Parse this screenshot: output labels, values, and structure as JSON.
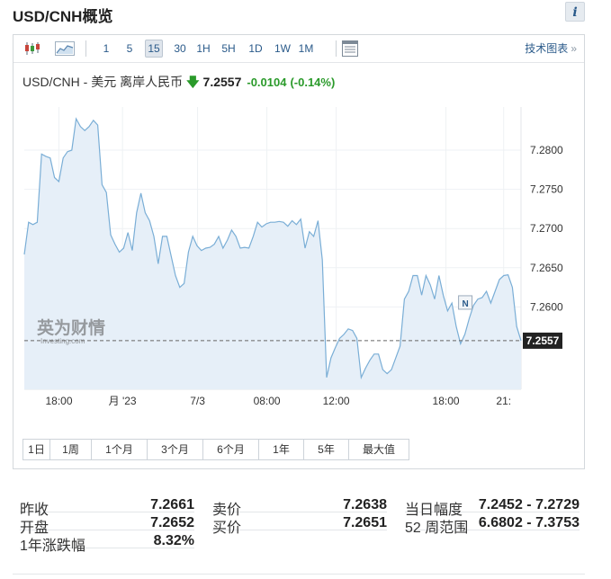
{
  "page": {
    "title": "USD/CNH概览",
    "info_icon": "i"
  },
  "toolbar": {
    "icons": [
      "candlestick-icon",
      "area-chart-icon",
      "settings-panel-icon"
    ],
    "timeframes": [
      "1",
      "5",
      "15",
      "30",
      "1H",
      "5H",
      "1D",
      "1W",
      "1M"
    ],
    "active_timeframe": "15",
    "tech_link": "技术图表",
    "tech_arrow": "»"
  },
  "quote": {
    "name": "USD/CNH - 美元 离岸人民币",
    "direction": "down",
    "arrow": "🡇",
    "price": "7.2557",
    "change": "-0.0104",
    "change_pct": "(-0.14%)"
  },
  "watermark": {
    "cn": "英为财情",
    "en": "Investing.com"
  },
  "news_marker": "N",
  "colors": {
    "line": "#7aaed6",
    "fill": "#e6eff8",
    "up": "#2a9a2a",
    "link": "#2a5a8a"
  },
  "chart_data": {
    "type": "area",
    "series": [
      {
        "values": [
          7.2667,
          7.2708,
          7.2705,
          7.2708,
          7.2795,
          7.2792,
          7.279,
          7.2765,
          7.276,
          7.279,
          7.2798,
          7.28,
          7.284,
          7.283,
          7.2825,
          7.283,
          7.2838,
          7.2832,
          7.2756,
          7.2746,
          7.2692,
          7.268,
          7.267,
          7.2675,
          7.2695,
          7.2672,
          7.272,
          7.2745,
          7.272,
          7.271,
          7.269,
          7.2655,
          7.269,
          7.269,
          7.2665,
          7.264,
          7.2625,
          7.263,
          7.267,
          7.269,
          7.2678,
          7.2672,
          7.2675,
          7.2676,
          7.268,
          7.269,
          7.2675,
          7.2685,
          7.2698,
          7.269,
          7.2675,
          7.2676,
          7.2675,
          7.269,
          7.2708,
          7.2702,
          7.2706,
          7.2708,
          7.2708,
          7.2709,
          7.2708,
          7.2703,
          7.271,
          7.2705,
          7.2712,
          7.2675,
          7.2696,
          7.269,
          7.271,
          7.266,
          7.251,
          7.2535,
          7.2548,
          7.256,
          7.2565,
          7.2572,
          7.257,
          7.256,
          7.251,
          7.2522,
          7.2532,
          7.254,
          7.254,
          7.252,
          7.2515,
          7.252,
          7.2535,
          7.255,
          7.261,
          7.262,
          7.264,
          7.264,
          7.2615,
          7.264,
          7.2628,
          7.261,
          7.264,
          7.2615,
          7.2595,
          7.2605,
          7.2575,
          7.2553,
          7.2565,
          7.2585,
          7.2602,
          7.261,
          7.2612,
          7.262,
          7.2605,
          7.262,
          7.2635,
          7.264,
          7.2641,
          7.2625,
          7.2575,
          7.2557
        ]
      }
    ],
    "x_ticks": [
      "18:00",
      "月 '23",
      "7/3",
      "08:00",
      "12:00",
      "18:00",
      "21:"
    ],
    "y_ticks": [
      7.28,
      7.275,
      7.27,
      7.265,
      7.26
    ],
    "y_tick_labels": [
      "7.2800",
      "7.2750",
      "7.2700",
      "7.2650",
      "7.2600"
    ],
    "ylim": [
      7.2495,
      7.2855
    ],
    "last_value": 7.2557,
    "last_label": "7.2557",
    "grid": true
  },
  "ranges": [
    "1日",
    "1周",
    "1个月",
    "3个月",
    "6个月",
    "1年",
    "5年",
    "最大值"
  ],
  "stats": {
    "col1": [
      {
        "label": "昨收",
        "value": "7.2661"
      },
      {
        "label": "开盘",
        "value": "7.2652"
      },
      {
        "label": "1年涨跌幅",
        "value": "8.32%"
      }
    ],
    "col2": [
      {
        "label": "卖价",
        "value": "7.2638"
      },
      {
        "label": "买价",
        "value": "7.2651"
      }
    ],
    "col3": [
      {
        "label": "当日幅度",
        "value": "7.2452 - 7.2729"
      },
      {
        "label": "52 周范围",
        "value": "6.6802 - 7.3753"
      }
    ]
  }
}
